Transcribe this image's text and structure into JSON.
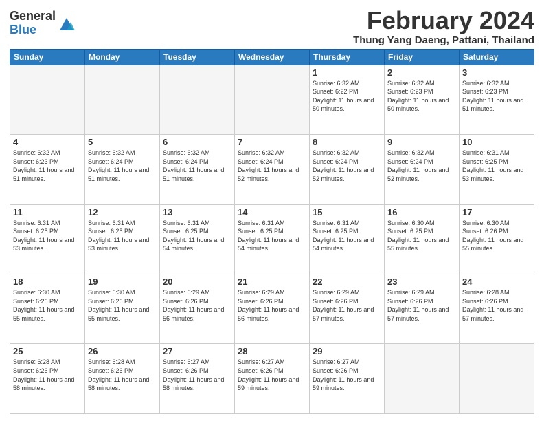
{
  "logo": {
    "general": "General",
    "blue": "Blue"
  },
  "title": "February 2024",
  "subtitle": "Thung Yang Daeng, Pattani, Thailand",
  "days_header": [
    "Sunday",
    "Monday",
    "Tuesday",
    "Wednesday",
    "Thursday",
    "Friday",
    "Saturday"
  ],
  "weeks": [
    [
      {
        "day": "",
        "info": ""
      },
      {
        "day": "",
        "info": ""
      },
      {
        "day": "",
        "info": ""
      },
      {
        "day": "",
        "info": ""
      },
      {
        "day": "1",
        "info": "Sunrise: 6:32 AM\nSunset: 6:22 PM\nDaylight: 11 hours and 50 minutes."
      },
      {
        "day": "2",
        "info": "Sunrise: 6:32 AM\nSunset: 6:23 PM\nDaylight: 11 hours and 50 minutes."
      },
      {
        "day": "3",
        "info": "Sunrise: 6:32 AM\nSunset: 6:23 PM\nDaylight: 11 hours and 51 minutes."
      }
    ],
    [
      {
        "day": "4",
        "info": "Sunrise: 6:32 AM\nSunset: 6:23 PM\nDaylight: 11 hours and 51 minutes."
      },
      {
        "day": "5",
        "info": "Sunrise: 6:32 AM\nSunset: 6:24 PM\nDaylight: 11 hours and 51 minutes."
      },
      {
        "day": "6",
        "info": "Sunrise: 6:32 AM\nSunset: 6:24 PM\nDaylight: 11 hours and 51 minutes."
      },
      {
        "day": "7",
        "info": "Sunrise: 6:32 AM\nSunset: 6:24 PM\nDaylight: 11 hours and 52 minutes."
      },
      {
        "day": "8",
        "info": "Sunrise: 6:32 AM\nSunset: 6:24 PM\nDaylight: 11 hours and 52 minutes."
      },
      {
        "day": "9",
        "info": "Sunrise: 6:32 AM\nSunset: 6:24 PM\nDaylight: 11 hours and 52 minutes."
      },
      {
        "day": "10",
        "info": "Sunrise: 6:31 AM\nSunset: 6:25 PM\nDaylight: 11 hours and 53 minutes."
      }
    ],
    [
      {
        "day": "11",
        "info": "Sunrise: 6:31 AM\nSunset: 6:25 PM\nDaylight: 11 hours and 53 minutes."
      },
      {
        "day": "12",
        "info": "Sunrise: 6:31 AM\nSunset: 6:25 PM\nDaylight: 11 hours and 53 minutes."
      },
      {
        "day": "13",
        "info": "Sunrise: 6:31 AM\nSunset: 6:25 PM\nDaylight: 11 hours and 54 minutes."
      },
      {
        "day": "14",
        "info": "Sunrise: 6:31 AM\nSunset: 6:25 PM\nDaylight: 11 hours and 54 minutes."
      },
      {
        "day": "15",
        "info": "Sunrise: 6:31 AM\nSunset: 6:25 PM\nDaylight: 11 hours and 54 minutes."
      },
      {
        "day": "16",
        "info": "Sunrise: 6:30 AM\nSunset: 6:25 PM\nDaylight: 11 hours and 55 minutes."
      },
      {
        "day": "17",
        "info": "Sunrise: 6:30 AM\nSunset: 6:26 PM\nDaylight: 11 hours and 55 minutes."
      }
    ],
    [
      {
        "day": "18",
        "info": "Sunrise: 6:30 AM\nSunset: 6:26 PM\nDaylight: 11 hours and 55 minutes."
      },
      {
        "day": "19",
        "info": "Sunrise: 6:30 AM\nSunset: 6:26 PM\nDaylight: 11 hours and 55 minutes."
      },
      {
        "day": "20",
        "info": "Sunrise: 6:29 AM\nSunset: 6:26 PM\nDaylight: 11 hours and 56 minutes."
      },
      {
        "day": "21",
        "info": "Sunrise: 6:29 AM\nSunset: 6:26 PM\nDaylight: 11 hours and 56 minutes."
      },
      {
        "day": "22",
        "info": "Sunrise: 6:29 AM\nSunset: 6:26 PM\nDaylight: 11 hours and 57 minutes."
      },
      {
        "day": "23",
        "info": "Sunrise: 6:29 AM\nSunset: 6:26 PM\nDaylight: 11 hours and 57 minutes."
      },
      {
        "day": "24",
        "info": "Sunrise: 6:28 AM\nSunset: 6:26 PM\nDaylight: 11 hours and 57 minutes."
      }
    ],
    [
      {
        "day": "25",
        "info": "Sunrise: 6:28 AM\nSunset: 6:26 PM\nDaylight: 11 hours and 58 minutes."
      },
      {
        "day": "26",
        "info": "Sunrise: 6:28 AM\nSunset: 6:26 PM\nDaylight: 11 hours and 58 minutes."
      },
      {
        "day": "27",
        "info": "Sunrise: 6:27 AM\nSunset: 6:26 PM\nDaylight: 11 hours and 58 minutes."
      },
      {
        "day": "28",
        "info": "Sunrise: 6:27 AM\nSunset: 6:26 PM\nDaylight: 11 hours and 59 minutes."
      },
      {
        "day": "29",
        "info": "Sunrise: 6:27 AM\nSunset: 6:26 PM\nDaylight: 11 hours and 59 minutes."
      },
      {
        "day": "",
        "info": ""
      },
      {
        "day": "",
        "info": ""
      }
    ]
  ]
}
